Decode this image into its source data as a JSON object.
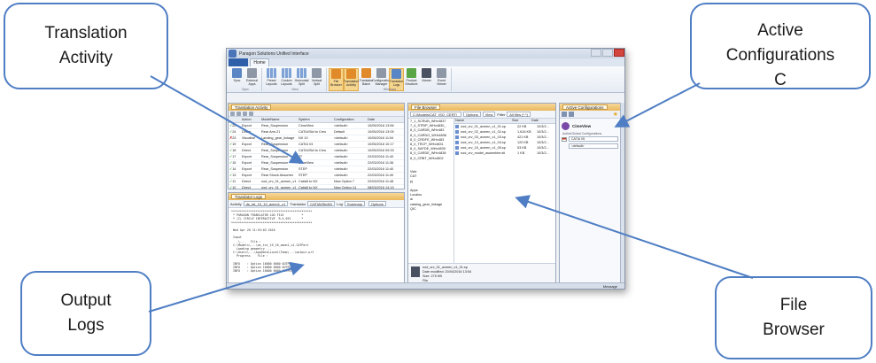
{
  "callouts": {
    "translation": "Translation\nActivity",
    "active": "Active\nConfigurations\nC",
    "output": "Output\nLogs",
    "file": "File\nBrowser"
  },
  "app": {
    "title": "Paragon Solutions Unified Interface",
    "file_tab": "",
    "home_tab": "Home",
    "ribbon": {
      "groups": [
        {
          "label": "Sync",
          "buttons": [
            "Sync",
            "External Apps"
          ]
        },
        {
          "label": "View",
          "buttons": [
            "Preset Layouts",
            "Custom Layouts",
            "Horizontal Split",
            "Vertical Split"
          ]
        },
        {
          "label": "Windows",
          "buttons": [
            "File Browser",
            "Translation Activity",
            "Translator Batch",
            "Configuration Manager",
            "Translator Logs",
            "Product Structure",
            "Viewer",
            "Event Viewer"
          ]
        }
      ]
    },
    "status": "Message",
    "activity": {
      "tab": "Translation Activity",
      "columns": [
        "",
        "Action",
        "ModelName",
        "System",
        "Configuration",
        "Date"
      ],
      "rows": [
        [
          "25",
          "Export",
          "Rear_Suspension",
          "CimeView",
          "<default>",
          "10/05/2016 13:56"
        ],
        [
          "24",
          "Direct",
          "Rear Arm.21",
          "CATIA/Std to Creo",
          "Default",
          "10/05/2016 13:05"
        ],
        [
          "23",
          "Visualise",
          "Landing_gear_linkage",
          "NX 10",
          "<default>",
          "10/05/2016 11:54"
        ],
        [
          "19",
          "Export",
          "Rear_Suspension",
          "CATIA V4",
          "<default>",
          "10/05/2016 10:17"
        ],
        [
          "18",
          "Direct",
          "Rear_Suspension",
          "CATIA/Std to Creo",
          "<default>",
          "10/05/2016 09:33"
        ],
        [
          "17",
          "Export",
          "Rear_Suspension",
          "JT",
          "<default>",
          "22/03/2016 11:40"
        ],
        [
          "15",
          "Export",
          "Rear_Suspension",
          "CimeView",
          "<default>",
          "22/03/2016 11:36"
        ],
        [
          "14",
          "Export",
          "Rear_Suspension",
          "STEP",
          "<default>",
          "22/03/2016 11:40"
        ],
        [
          "13",
          "Export",
          "Rear Shock Absorber",
          "STEP",
          "<default>",
          "22/03/2016 11:40"
        ],
        [
          "11",
          "Direct",
          "nod_crv_01_axmen_v1",
          "Catia5 to NX",
          "New Option 7",
          "22/03/2016 11:48"
        ],
        [
          "10",
          "Direct",
          "nod_crv_01_axmen_v1",
          "Catia5 to NX",
          "New Option 14",
          "08/03/2016 14:19"
        ]
      ],
      "status": [
        "ok",
        "ok",
        "err",
        "ok",
        "ok",
        "ok",
        "ok",
        "ok",
        "ok",
        "ok",
        "ok"
      ]
    },
    "logs": {
      "tab": "Translator Logs",
      "activity_label": "Activity",
      "activity_value": "ds_tst_19_10_axmn1_v1",
      "translator_label": "Translator",
      "translator_value": "CATIAV5toNX",
      "log_label": "Log",
      "log_value": "Summary",
      "options": "Options",
      "lines": [
        "**********************************************",
        " * PARAGON TRANSLATOR LOG FILE          *",
        " * (C) CIRCLE INTERACTIVE  R.4.031      *",
        "**********************************************",
        "",
        " Wed Apr 20 11:53:03 2016",
        "",
        " Input",
        "   .\\...   File :",
        " C:\\Models\\...\\ds_tst_19_10_axmn1_v1.CATPart",
        "   Loading geometry ...",
        " C:\\Users\\...\\AppData\\Local\\Temp\\...\\output.prt",
        "   Progress    File :",
        "",
        " INFO    : Option 16000 0000 OUTPUT",
        " INFO    : Option 16000 0000 OUTPUT",
        " INFO    : Option 16000 0000 OUTPUT"
      ]
    },
    "browser": {
      "tab": "File Browser",
      "path": "C:\\Models\\CAT_ISO_CERT\\",
      "options": "Options",
      "view": "View",
      "filter_label": "Filter",
      "filter_value": "All files (*.*)",
      "tree": [
        "7_1_SCRUB_WHx4837",
        "7_4_STRIP_WHx4830_",
        "8_0_CARDB_WHx483",
        "8_0_CARDO_WHx4836",
        "8_0_CRDFE_WHx483",
        "8_0_TRCP_WHx4831",
        "8_0_SAFDE_WHx4839",
        "8_0_CARDE_WHx4838",
        "8_0_CRBT_WHx4802",
        "",
        "",
        "Vide",
        "CAT",
        "pj",
        "",
        "Apps",
        "Localus",
        "ai",
        "catalog_gear_linkage",
        "QIC"
      ],
      "file_columns": [
        "Name",
        "Size",
        "Date"
      ],
      "files": [
        [
          "nod_crv_01_axmen_v1_01.sp",
          "22 KB",
          "10/3/2..."
        ],
        [
          "nod_crv_02_axmen_v1_02.sp",
          "1,616 KB",
          "10/3/2..."
        ],
        [
          "nod_crv_03_axmen_v1_03.sp",
          "421 KB",
          "10/3/2..."
        ],
        [
          "nod_crv_14_axmen_v1_04.sp",
          "120 KB",
          "10/3/2..."
        ],
        [
          "nod_crv_15_axmen_v1_05.sp",
          "53 KB",
          "10/3/2..."
        ],
        [
          "nod_crv_model_assembler.stl",
          "1 KB",
          "10/3/2..."
        ]
      ],
      "detail_name": "nod_crv_01_axmen_v1_01.sp",
      "detail_date": "Date modified: 20/04/2016 13:54",
      "detail_size": "Size: 275 KB",
      "detail_type": "File"
    },
    "config": {
      "tab": "Active Configurations",
      "title": "CimeView",
      "subtitle": "Active/Global Configurations",
      "translator": "CATIA V5",
      "setting": "<default>"
    }
  }
}
